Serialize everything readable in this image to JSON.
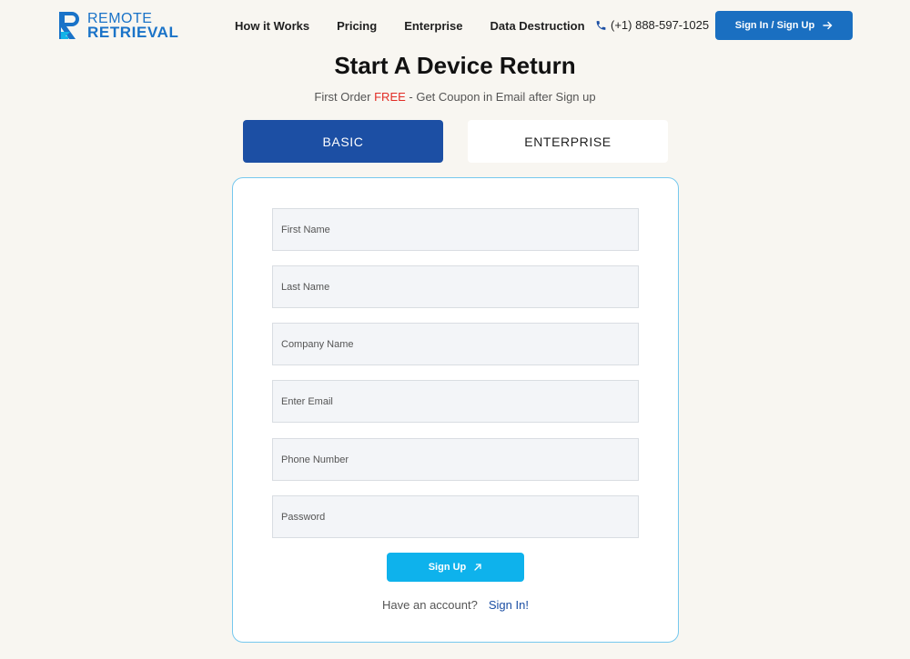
{
  "header": {
    "logo": {
      "line1": "REMOTE",
      "line2": "RETRIEVAL"
    },
    "nav": [
      {
        "label": "How it Works"
      },
      {
        "label": "Pricing"
      },
      {
        "label": "Enterprise"
      },
      {
        "label": "Data Destruction"
      }
    ],
    "phone": "(+1) 888-597-1025",
    "signin_label": "Sign In / Sign Up"
  },
  "page": {
    "title": "Start A Device Return",
    "subtitle_before": "First Order ",
    "subtitle_free": "FREE",
    "subtitle_after": " - Get Coupon in Email after Sign up"
  },
  "tabs": {
    "basic": "BASIC",
    "enterprise": "ENTERPRISE"
  },
  "form": {
    "first_name": "First Name",
    "last_name": "Last Name",
    "company_name": "Company Name",
    "email": "Enter Email",
    "phone": "Phone Number",
    "password": "Password",
    "signup_label": "Sign Up",
    "account_prompt": "Have an account?",
    "signin_link": "Sign In!"
  },
  "colors": {
    "brand_blue": "#1a6fc1",
    "tab_active": "#1c4fa4",
    "signup_button": "#0eb2ec",
    "free_red": "#e22d26",
    "background": "#f8f6f1"
  }
}
